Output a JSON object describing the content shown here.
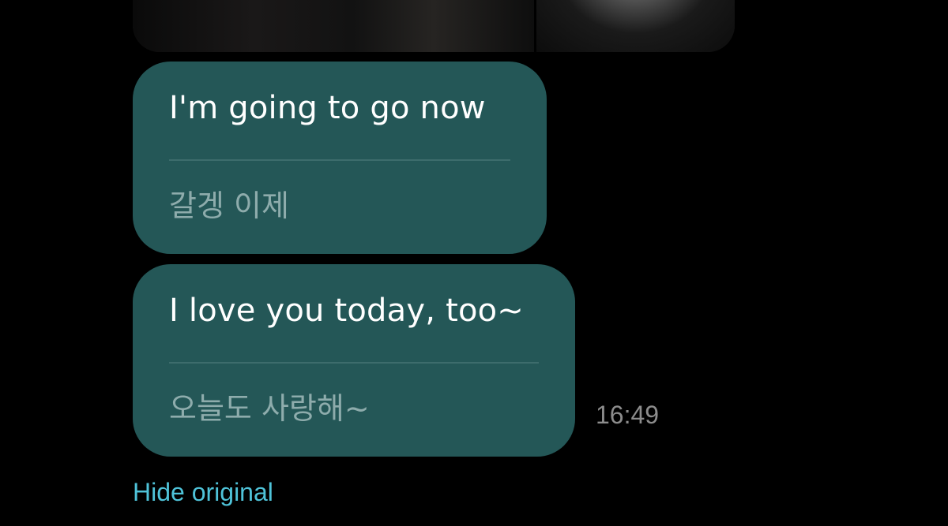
{
  "messages": [
    {
      "translated": "I'm going to go now",
      "original": "갈겡 이제"
    },
    {
      "translated": "I love you today, too~",
      "original": "오늘도 사랑해~"
    }
  ],
  "timestamp": "16:49",
  "hide_original_label": "Hide original",
  "colors": {
    "background": "#000000",
    "bubble": "#245757",
    "translated_text": "#ffffff",
    "original_text": "#8eacac",
    "link": "#4fc3d9",
    "timestamp": "#8c8c8c"
  }
}
